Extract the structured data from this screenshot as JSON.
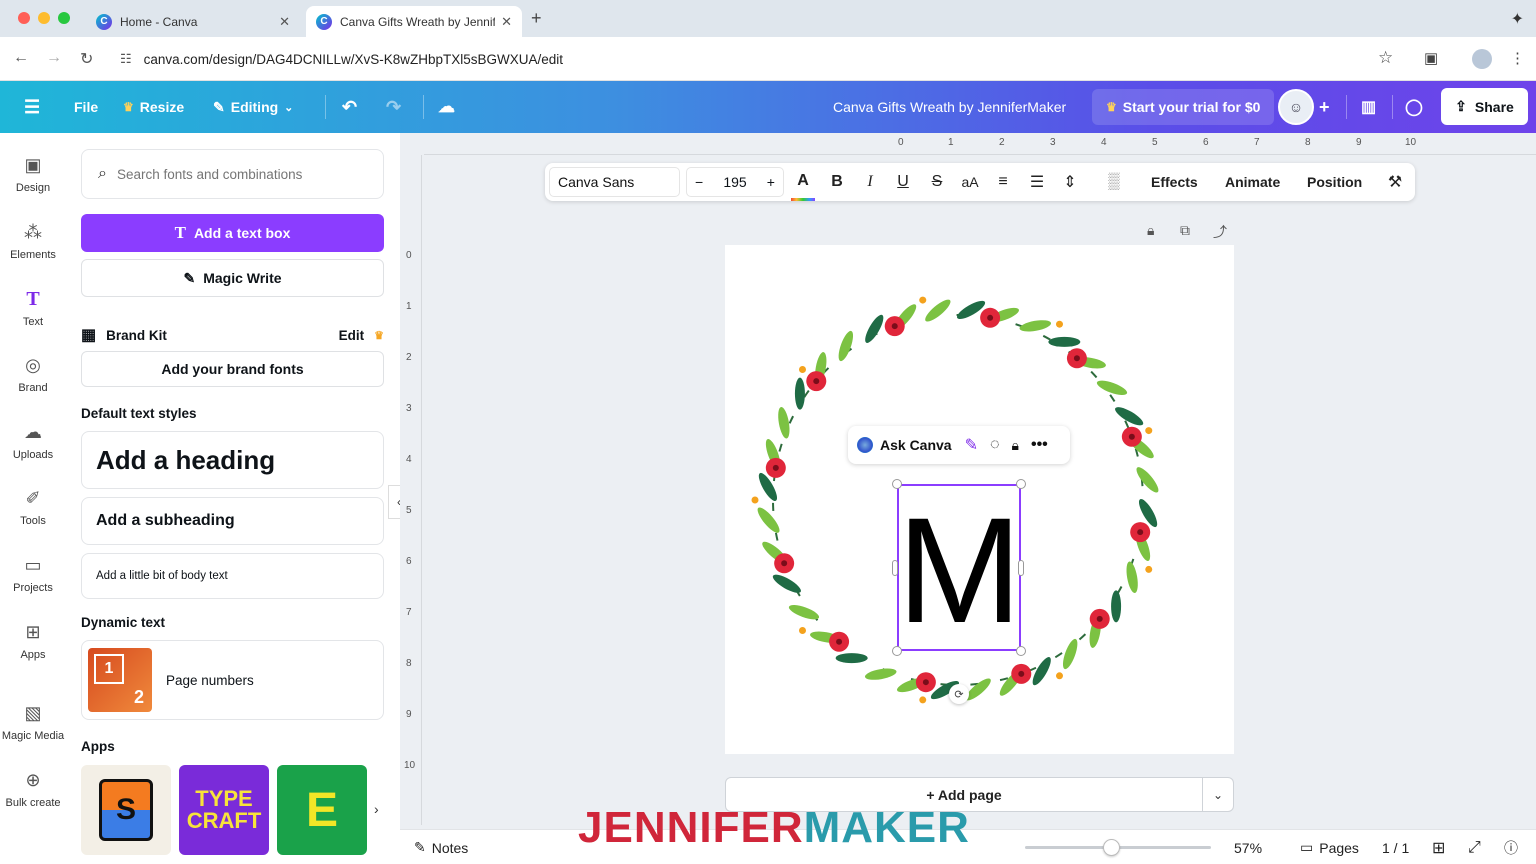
{
  "browser": {
    "tabs": [
      {
        "title": "Home - Canva",
        "close": "✕"
      },
      {
        "title": "Canva Gifts Wreath by Jennif",
        "close": "✕"
      }
    ],
    "new_tab": "+",
    "url": "canva.com/design/DAG4DCNILLw/XvS-K8wZHbpTXl5sBGWXUA/edit"
  },
  "topbar": {
    "file": "File",
    "resize": "Resize",
    "editing": "Editing",
    "doc_title": "Canva Gifts Wreath by JenniferMaker",
    "trial": "Start your trial for $0",
    "share": "Share"
  },
  "rail": {
    "items": [
      {
        "label": "Design"
      },
      {
        "label": "Elements"
      },
      {
        "label": "Text"
      },
      {
        "label": "Brand"
      },
      {
        "label": "Uploads"
      },
      {
        "label": "Tools"
      },
      {
        "label": "Projects"
      },
      {
        "label": "Apps"
      },
      {
        "label": "Magic Media"
      },
      {
        "label": "Bulk create"
      }
    ]
  },
  "panel": {
    "search_placeholder": "Search fonts and combinations",
    "add_text_box": "Add a text box",
    "magic_write": "Magic Write",
    "brand_kit": "Brand Kit",
    "brand_edit": "Edit",
    "add_brand_fonts": "Add your brand fonts",
    "default_styles": "Default text styles",
    "heading": "Add a heading",
    "subheading": "Add a subheading",
    "body": "Add a little bit of body text",
    "dynamic_text": "Dynamic text",
    "page_numbers": "Page numbers",
    "apps": "Apps",
    "app_tiles": [
      "S",
      "TYPE CRAFT",
      "E"
    ]
  },
  "ruler": {
    "top": [
      "0",
      "1",
      "2",
      "3",
      "4",
      "5",
      "6",
      "7",
      "8",
      "9",
      "10"
    ],
    "left": [
      "0",
      "1",
      "2",
      "3",
      "4",
      "5",
      "6",
      "7",
      "8",
      "9",
      "10"
    ]
  },
  "text_toolbar": {
    "font": "Canva Sans",
    "minus": "−",
    "size": "195",
    "plus": "+",
    "effects": "Effects",
    "animate": "Animate",
    "position": "Position"
  },
  "canvas": {
    "ask_canva": "Ask Canva",
    "letter": "M",
    "add_page": "+ Add page"
  },
  "footer": {
    "notes": "Notes",
    "zoom": "57%",
    "zoom_level": 0.57,
    "pages": "Pages",
    "page_count": "1 / 1"
  },
  "watermark": {
    "part1": "JENNIFER",
    "part2": "MAKER"
  },
  "colors": {
    "accent": "#8b3dff",
    "wm_red": "#d0263a",
    "wm_teal": "#2a9bab"
  }
}
